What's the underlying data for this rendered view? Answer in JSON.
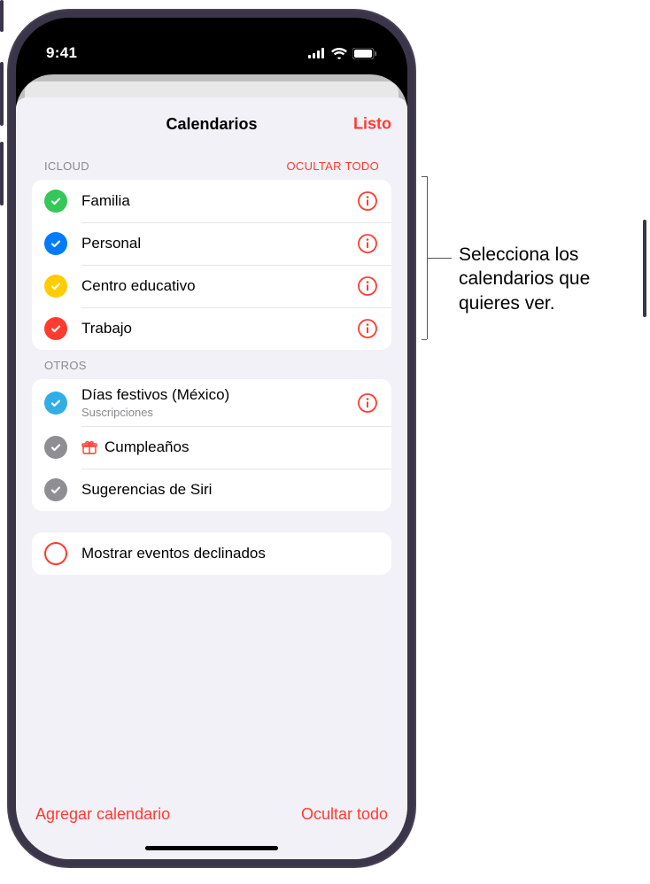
{
  "status": {
    "time": "9:41"
  },
  "modal": {
    "title": "Calendarios",
    "done_label": "Listo"
  },
  "sections": {
    "icloud": {
      "label": "ICLOUD",
      "action": "OCULTAR TODO",
      "items": {
        "familia": {
          "label": "Familia",
          "color": "#34c759"
        },
        "personal": {
          "label": "Personal",
          "color": "#007aff"
        },
        "centro": {
          "label": "Centro educativo",
          "color": "#ffcc00"
        },
        "trabajo": {
          "label": "Trabajo",
          "color": "#ff3b30"
        }
      }
    },
    "otros": {
      "label": "OTROS",
      "items": {
        "festivos": {
          "label": "Días festivos (México)",
          "sub": "Suscripciones",
          "color": "#32ade6"
        },
        "cumple": {
          "label": "Cumpleaños",
          "color": "#8e8e93",
          "icon": "gift"
        },
        "siri": {
          "label": "Sugerencias de Siri",
          "color": "#8e8e93"
        }
      }
    }
  },
  "declined": {
    "label": "Mostrar eventos declinados"
  },
  "footer": {
    "add_label": "Agregar calendario",
    "hide_label": "Ocultar todo"
  },
  "callout": {
    "text": "Selecciona los calendarios que quieres ver."
  },
  "colors": {
    "accent": "#ff3b30"
  }
}
